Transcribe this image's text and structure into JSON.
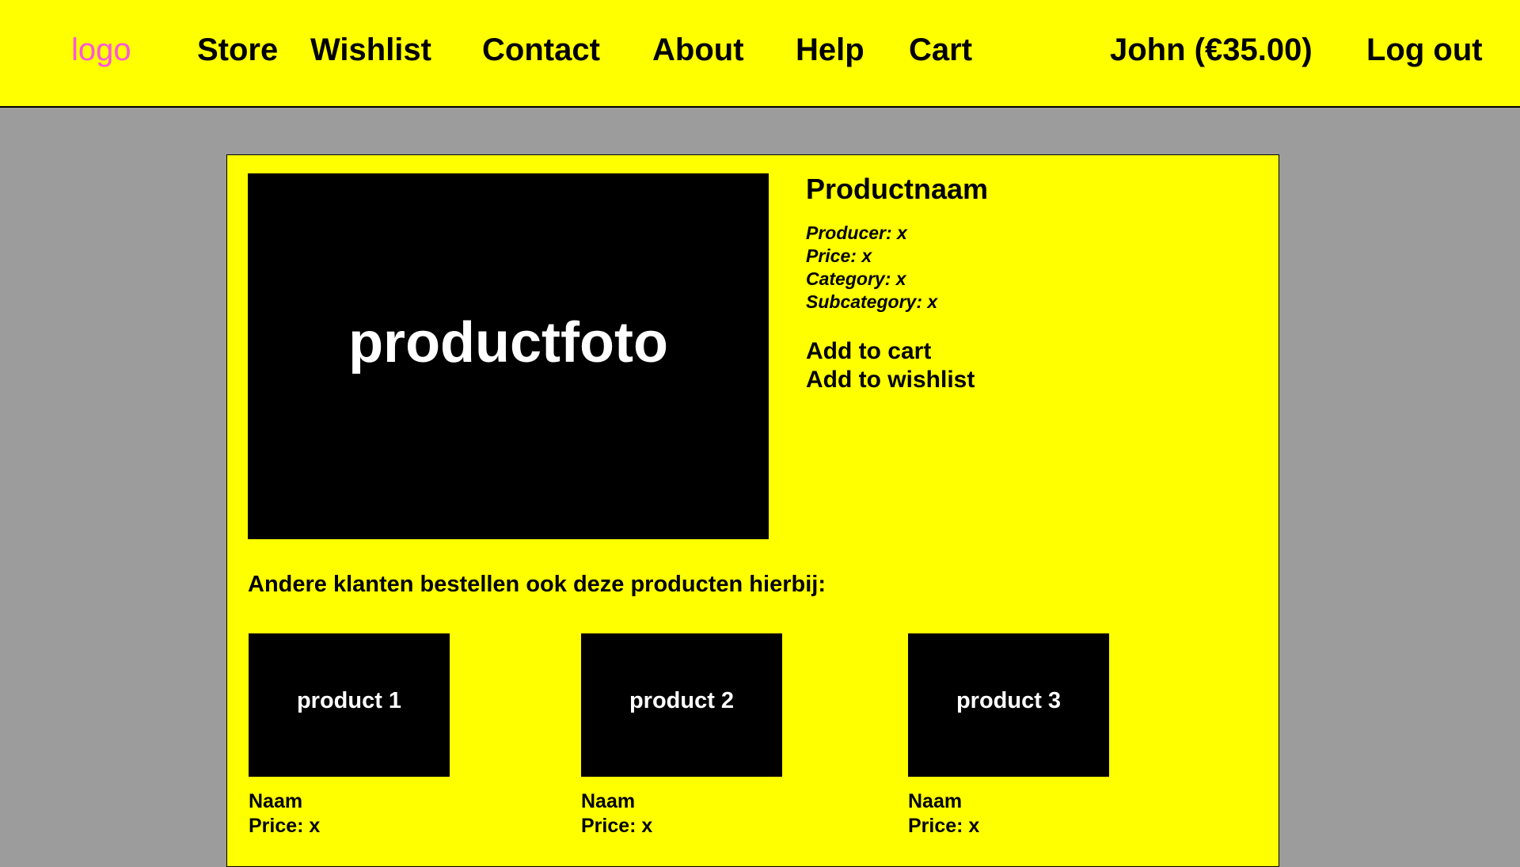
{
  "colors": {
    "background": "#9c9c9c",
    "panel": "#ffff00",
    "logo": "#ff55dd",
    "text": "#000000",
    "image_placeholder": "#000000",
    "image_text": "#ffffff"
  },
  "header": {
    "logo": "logo",
    "nav": [
      "Store",
      "Wishlist",
      "Contact",
      "About",
      "Help",
      "Cart"
    ],
    "user": "John (€35.00)",
    "logout": "Log out"
  },
  "product": {
    "photo_label": "productfoto",
    "name": "Productnaam",
    "attributes": [
      "Producer: x",
      "Price: x",
      "Category: x",
      "Subcategory: x"
    ],
    "actions": {
      "add_to_cart": "Add to cart",
      "add_to_wishlist": "Add to wishlist"
    }
  },
  "recommendations": {
    "heading": "Andere klanten bestellen ook deze producten hierbij:",
    "items": [
      {
        "image_label": "product 1",
        "name": "Naam",
        "price": "Price: x"
      },
      {
        "image_label": "product 2",
        "name": "Naam",
        "price": "Price: x"
      },
      {
        "image_label": "product 3",
        "name": "Naam",
        "price": "Price: x"
      }
    ]
  }
}
